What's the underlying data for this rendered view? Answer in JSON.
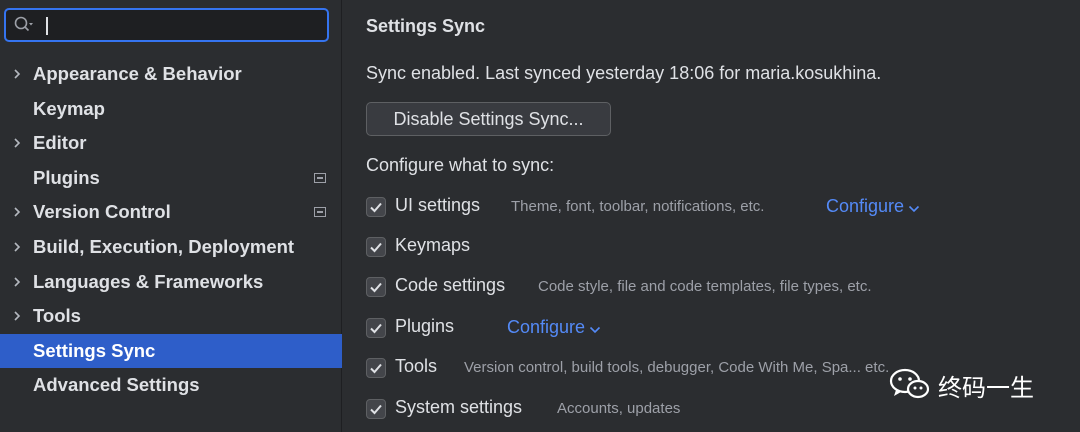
{
  "search": {
    "value": "",
    "placeholder": ""
  },
  "sidebar": {
    "items": [
      {
        "label": "Appearance & Behavior",
        "expandable": true,
        "badge": false,
        "selected": false
      },
      {
        "label": "Keymap",
        "expandable": false,
        "badge": false,
        "selected": false
      },
      {
        "label": "Editor",
        "expandable": true,
        "badge": false,
        "selected": false
      },
      {
        "label": "Plugins",
        "expandable": false,
        "badge": true,
        "selected": false
      },
      {
        "label": "Version Control",
        "expandable": true,
        "badge": true,
        "selected": false
      },
      {
        "label": "Build, Execution, Deployment",
        "expandable": true,
        "badge": false,
        "selected": false
      },
      {
        "label": "Languages & Frameworks",
        "expandable": true,
        "badge": false,
        "selected": false
      },
      {
        "label": "Tools",
        "expandable": true,
        "badge": false,
        "selected": false
      },
      {
        "label": "Settings Sync",
        "expandable": false,
        "badge": false,
        "selected": true
      },
      {
        "label": "Advanced Settings",
        "expandable": false,
        "badge": false,
        "selected": false
      }
    ]
  },
  "main": {
    "title": "Settings Sync",
    "status": "Sync enabled. Last synced yesterday 18:06 for maria.kosukhina.",
    "disable_button": "Disable Settings Sync...",
    "section_label": "Configure what to sync:",
    "options": [
      {
        "label": "UI settings",
        "checked": true,
        "description": "Theme, font, toolbar, notifications, etc.",
        "link": "Configure"
      },
      {
        "label": "Keymaps",
        "checked": true,
        "description": "",
        "link": ""
      },
      {
        "label": "Code settings",
        "checked": true,
        "description": "Code style, file and code templates, file types, etc.",
        "link": ""
      },
      {
        "label": "Plugins",
        "checked": true,
        "description": "",
        "link": "Configure"
      },
      {
        "label": "Tools",
        "checked": true,
        "description": "Version control, build tools, debugger, Code With Me, Spa... etc.",
        "link": ""
      },
      {
        "label": "System settings",
        "checked": true,
        "description": "Accounts, updates",
        "link": ""
      }
    ]
  },
  "watermark": {
    "text": "终码一生"
  },
  "colors": {
    "background": "#2b2d30",
    "selection": "#2e5ec9",
    "focus_border": "#3574f0",
    "link": "#548af7",
    "text": "#dfe1e5",
    "muted_text": "#9da0a8"
  },
  "icons": {
    "search": "search-icon",
    "expand": "chevron-right-icon",
    "badge": "project-settings-icon",
    "checkbox": "checkmark-icon",
    "link_dropdown": "chevron-down-icon",
    "watermark_logo": "wechat-icon"
  }
}
